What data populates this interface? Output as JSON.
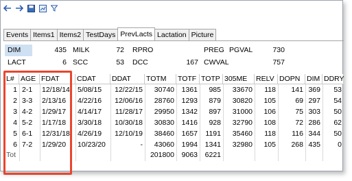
{
  "toolbar": {
    "icons": [
      "back-arrow-icon",
      "forward-arrow-icon",
      "save-icon",
      "chart-icon",
      "filter-icon"
    ]
  },
  "tabs": [
    "Events",
    "Items1",
    "Items2",
    "TestDays",
    "PrevLacts",
    "Lactation",
    "Picture"
  ],
  "active_tab": "PrevLacts",
  "summary": {
    "row1": {
      "k1": "DIM",
      "v1": "435",
      "k2": "MILK",
      "v2": "72",
      "k3": "RPRO",
      "k4": "PREG",
      "k5": "PGVAL",
      "v5": "730"
    },
    "row2": {
      "k1": "LACT",
      "v1": "6",
      "k2": "SCC",
      "v2": "53",
      "k3": "DCC",
      "v3": "167",
      "k4": "CWVAL",
      "v4": "757"
    }
  },
  "table": {
    "columns": [
      "L#",
      "AGE",
      "FDAT",
      "CDAT",
      "DDAT",
      "TOTM",
      "TOTF",
      "TOTP",
      "305ME",
      "RELV",
      "DOPN",
      "DIM",
      "DDRY"
    ],
    "rows": [
      [
        "1",
        "2-1",
        "12/18/14",
        "5/08/15",
        "12/22/15",
        "30740",
        "1361",
        "985",
        "33670",
        "118",
        "141",
        "369",
        "53"
      ],
      [
        "2",
        "3-3",
        "2/13/16",
        "4/22/16",
        "12/06/16",
        "28760",
        "1293",
        "879",
        "30820",
        "105",
        "69",
        "297",
        "54"
      ],
      [
        "3",
        "4-2",
        "1/29/17",
        "4/14/17",
        "11/28/17",
        "29950",
        "1342",
        "897",
        "31000",
        "106",
        "75",
        "303",
        "50"
      ],
      [
        "4",
        "5-2",
        "1/17/18",
        "3/30/18",
        "10/30/18",
        "30830",
        "1416",
        "928",
        "32790",
        "108",
        "72",
        "286",
        "62"
      ],
      [
        "5",
        "6-1",
        "12/31/18",
        "4/26/19",
        "12/10/19",
        "38460",
        "1657",
        "1191",
        "35460",
        "118",
        "116",
        "344",
        "50"
      ],
      [
        "6",
        "7-2",
        "1/29/20",
        "10/23/20",
        "-",
        "43060",
        "1994",
        "1341",
        "32980",
        "105",
        "268",
        "435",
        "0"
      ]
    ],
    "total_row": {
      "label": "Tot",
      "totm": "201800",
      "totf": "9063",
      "totp": "6221"
    }
  },
  "colors": {
    "highlight": "#cfe0f2",
    "redbox": "#e8452e",
    "tab_bg": "#f0f0f0"
  }
}
